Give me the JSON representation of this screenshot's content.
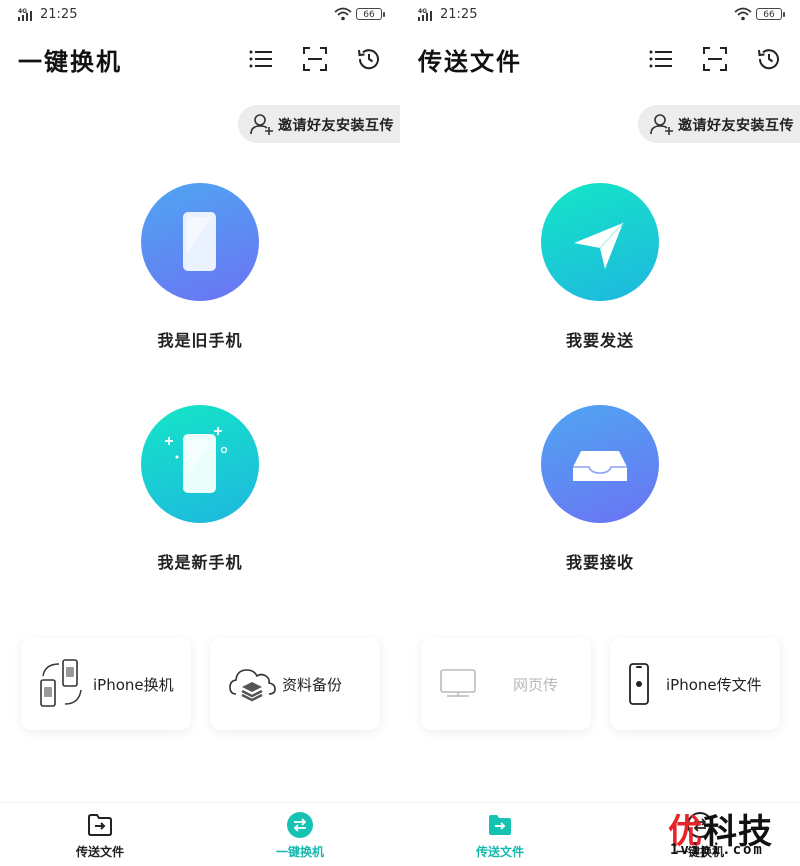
{
  "status_bar": {
    "network": "4G",
    "time": "21:25",
    "battery": "66"
  },
  "left_screen": {
    "title": "一键换机",
    "invite_label": "邀请好友安装互传",
    "options": [
      {
        "label": "我是旧手机",
        "icon": "phone-icon"
      },
      {
        "label": "我是新手机",
        "icon": "new-phone-sparkle-icon"
      }
    ],
    "cards": [
      {
        "label": "iPhone换机",
        "icon": "phone-swap-icon"
      },
      {
        "label": "资料备份",
        "icon": "cloud-backup-icon"
      }
    ],
    "nav": [
      {
        "label": "传送文件",
        "icon": "folder-arrow-icon",
        "active": false
      },
      {
        "label": "一键换机",
        "icon": "swap-arrows-icon",
        "active": true
      }
    ]
  },
  "right_screen": {
    "title": "传送文件",
    "invite_label": "邀请好友安装互传",
    "options": [
      {
        "label": "我要发送",
        "icon": "paper-plane-icon"
      },
      {
        "label": "我要接收",
        "icon": "inbox-tray-icon"
      }
    ],
    "cards": [
      {
        "label": "网页传",
        "icon": "monitor-icon",
        "disabled": true
      },
      {
        "label": "iPhone传文件",
        "icon": "iphone-icon"
      }
    ],
    "nav": [
      {
        "label": "传送文件",
        "icon": "folder-arrow-icon",
        "active": true
      },
      {
        "label": "一键换机",
        "icon": "swap-arrows-icon",
        "active": false
      }
    ]
  },
  "watermark": {
    "logo_text": "优科技",
    "logo_first_char": "优",
    "logo_rest": "科技",
    "url": "1vipi.com"
  },
  "colors": {
    "accent_teal": "#16b9b0",
    "blue_gradient": [
      "#4fa6f2",
      "#6b73f3"
    ],
    "teal_gradient": [
      "#14e6c6",
      "#1fb6e0"
    ]
  }
}
